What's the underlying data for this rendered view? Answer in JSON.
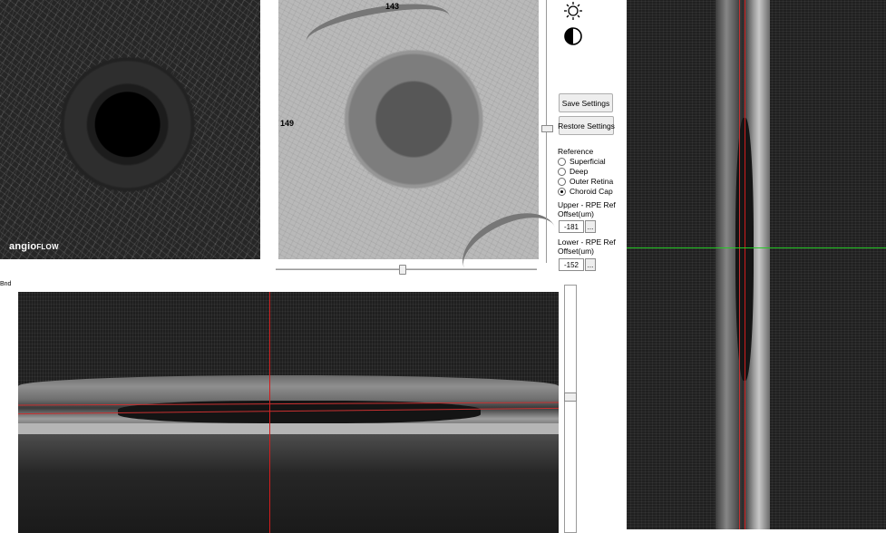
{
  "angio": {
    "logo_main": "angio",
    "logo_sub": "FLOW"
  },
  "enface": {
    "label_top": "143",
    "label_left": "149"
  },
  "toolbar": {
    "brightness_icon": "sun-icon",
    "contrast_icon": "contrast-icon",
    "save_label": "Save Settings",
    "restore_label": "Restore Settings"
  },
  "reference": {
    "title": "Reference",
    "options": [
      "Superficial",
      "Deep",
      "Outer Retina",
      "Choroid Cap"
    ],
    "selected": "Choroid Cap"
  },
  "offsets": {
    "upper_label_1": "Upper - RPE Ref",
    "upper_label_2": "Offset(um)",
    "upper_value": "-181",
    "lower_label_1": "Lower - RPE Ref",
    "lower_label_2": "Offset(um)",
    "lower_value": "-152",
    "browse_label": "..."
  },
  "bscan": {
    "label": "Bnd"
  },
  "colors": {
    "crosshair_red": "#d21d1d",
    "crosshair_green": "#25c825",
    "button_bg": "#eeeeee"
  }
}
